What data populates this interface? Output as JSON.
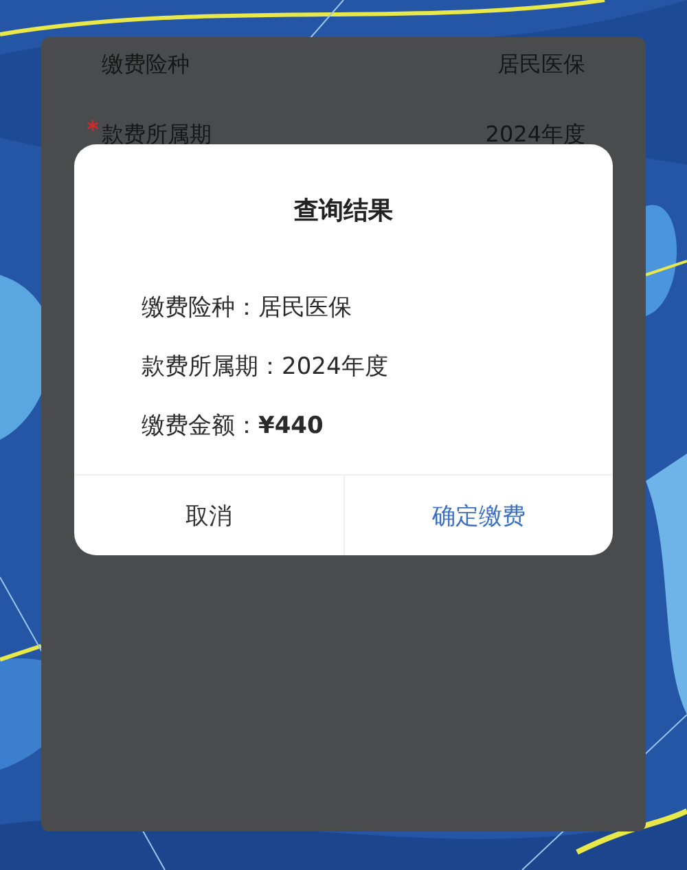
{
  "form_rows": [
    {
      "label": "缴费险种",
      "value": "居民医保"
    },
    {
      "label": "款费所属期",
      "value": "2024年度",
      "required_mark": "*"
    }
  ],
  "dialog": {
    "title": "查询结果",
    "lines": [
      "缴费险种：居民医保",
      "款费所属期：2024年度",
      "缴费金额：**¥440**"
    ],
    "buttons": [
      {
        "label": "取消",
        "kind": "cancel"
      },
      {
        "label": "确定缴费",
        "kind": "confirm"
      }
    ]
  }
}
